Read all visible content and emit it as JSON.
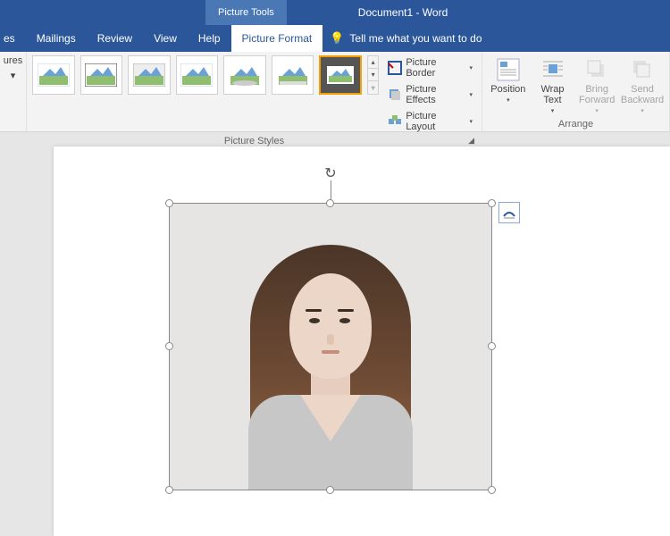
{
  "title": {
    "contextual_tab": "Picture Tools",
    "document": "Document1 - Word"
  },
  "tabs": {
    "partial": "es",
    "items": [
      "Mailings",
      "Review",
      "View",
      "Help",
      "Picture Format"
    ],
    "active_index": 4
  },
  "tell_me": "Tell me what you want to do",
  "ribbon": {
    "left_group_partial": {
      "label1": "ures",
      "caret": "▾"
    },
    "styles_label": "Picture Styles",
    "picture_border": "Picture Border",
    "picture_effects": "Picture Effects",
    "picture_layout": "Picture Layout",
    "arrange_label": "Arrange",
    "position": "Position",
    "wrap_text_l1": "Wrap",
    "wrap_text_l2": "Text",
    "bring_forward_l1": "Bring",
    "bring_forward_l2": "Forward",
    "send_backward_l1": "Send",
    "send_backward_l2": "Backward"
  },
  "picture": {
    "alt": "portrait photo of a woman in a gray v-neck shirt"
  }
}
